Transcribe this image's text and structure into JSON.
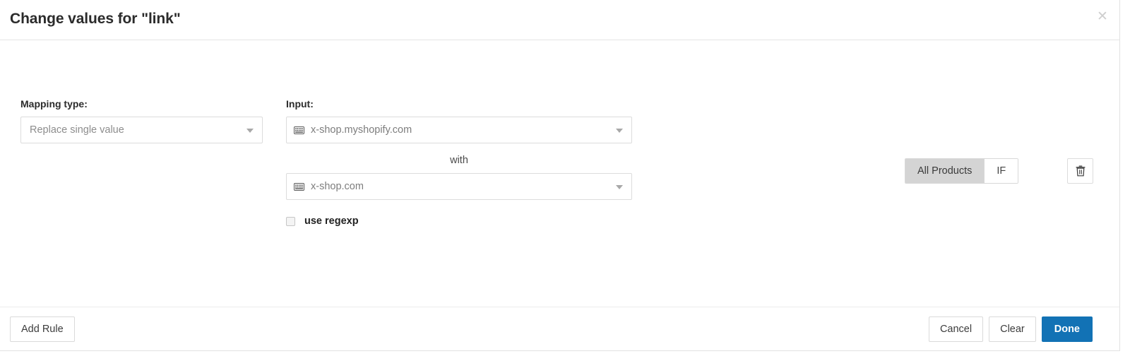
{
  "header": {
    "title": "Change values for \"link\"",
    "close_label": "✕"
  },
  "body": {
    "mapping": {
      "label": "Mapping type:",
      "selected": "Replace single value"
    },
    "input": {
      "label": "Input:",
      "from_value": "x-shop.myshopify.com",
      "with_label": "with",
      "to_value": "x-shop.com",
      "from_icon": "keyboard-icon",
      "to_icon": "keyboard-icon"
    },
    "regexp": {
      "label": "use regexp",
      "checked": false
    },
    "scope": {
      "options": [
        {
          "label": "All Products",
          "active": true
        },
        {
          "label": "IF",
          "active": false
        }
      ]
    },
    "delete": {
      "icon": "trash-icon"
    }
  },
  "footer": {
    "add_rule_label": "Add Rule",
    "cancel_label": "Cancel",
    "clear_label": "Clear",
    "done_label": "Done"
  },
  "colors": {
    "primary": "#1272b5",
    "border": "#dcdcdc",
    "toggle_active_bg": "#d4d4d4",
    "text": "#2b2b2b",
    "muted_text": "#8d8d8d"
  }
}
